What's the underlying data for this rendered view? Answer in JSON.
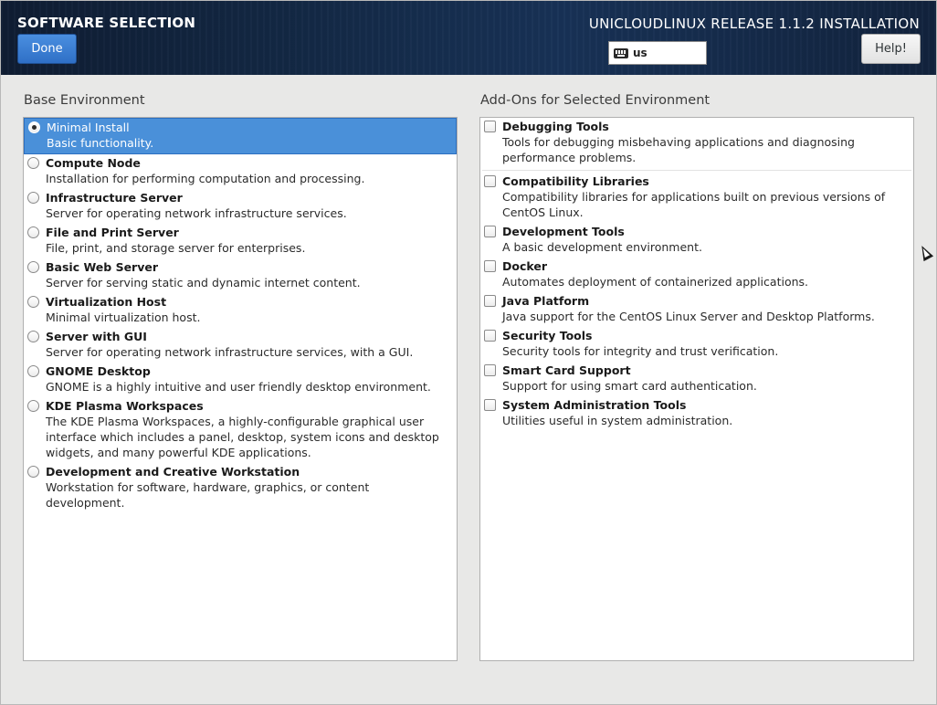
{
  "header": {
    "spoke_title": "SOFTWARE SELECTION",
    "done_label": "Done",
    "install_title": "UNICLOUDLINUX RELEASE 1.1.2 INSTALLATION",
    "keyboard_layout": "us",
    "help_label": "Help!"
  },
  "base_environment": {
    "heading": "Base Environment",
    "items": [
      {
        "title": "Minimal Install",
        "desc": "Basic functionality.",
        "selected": true
      },
      {
        "title": "Compute Node",
        "desc": "Installation for performing computation and processing."
      },
      {
        "title": "Infrastructure Server",
        "desc": "Server for operating network infrastructure services."
      },
      {
        "title": "File and Print Server",
        "desc": "File, print, and storage server for enterprises."
      },
      {
        "title": "Basic Web Server",
        "desc": "Server for serving static and dynamic internet content."
      },
      {
        "title": "Virtualization Host",
        "desc": "Minimal virtualization host."
      },
      {
        "title": "Server with GUI",
        "desc": "Server for operating network infrastructure services, with a GUI."
      },
      {
        "title": "GNOME Desktop",
        "desc": "GNOME is a highly intuitive and user friendly desktop environment."
      },
      {
        "title": "KDE Plasma Workspaces",
        "desc": "The KDE Plasma Workspaces, a highly-configurable graphical user interface which includes a panel, desktop, system icons and desktop widgets, and many powerful KDE applications."
      },
      {
        "title": "Development and Creative Workstation",
        "desc": "Workstation for software, hardware, graphics, or content development."
      }
    ]
  },
  "addons": {
    "heading": "Add-Ons for Selected Environment",
    "items": [
      {
        "title": "Debugging Tools",
        "desc": "Tools for debugging misbehaving applications and diagnosing performance problems."
      },
      {
        "title": "Compatibility Libraries",
        "desc": "Compatibility libraries for applications built on previous versions of CentOS Linux."
      },
      {
        "title": "Development Tools",
        "desc": "A basic development environment."
      },
      {
        "title": "Docker",
        "desc": "Automates deployment of containerized applications."
      },
      {
        "title": "Java Platform",
        "desc": "Java support for the CentOS Linux Server and Desktop Platforms."
      },
      {
        "title": "Security Tools",
        "desc": "Security tools for integrity and trust verification."
      },
      {
        "title": "Smart Card Support",
        "desc": "Support for using smart card authentication."
      },
      {
        "title": "System Administration Tools",
        "desc": "Utilities useful in system administration."
      }
    ]
  }
}
